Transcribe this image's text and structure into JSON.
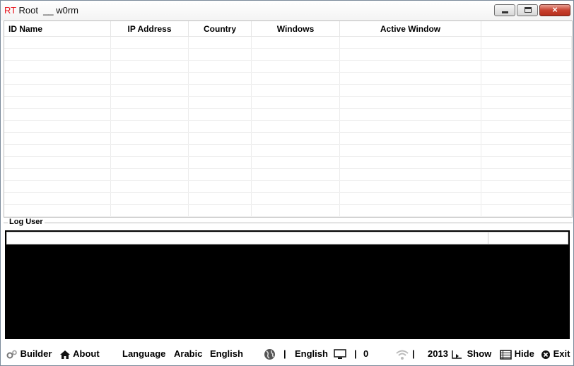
{
  "window": {
    "title_prefix": "RT",
    "title_rest": " Root  __ w0rm"
  },
  "grid": {
    "columns": [
      "ID Name",
      "IP Address",
      "Country",
      "Windows",
      "Active Window",
      ""
    ],
    "rows": []
  },
  "log": {
    "label": "Log User"
  },
  "statusbar": {
    "builder": "Builder",
    "about": "About",
    "language": "Language",
    "arabic": "Arabic",
    "english": "English",
    "sep1": "|",
    "lang_current": "English",
    "sep2": "|",
    "count": "0",
    "sep3": "|",
    "year": "2013",
    "show": "Show",
    "hide": "Hide",
    "exit": "Exit"
  },
  "icons": {
    "builder": "gears-icon",
    "about": "home-icon",
    "language": "globe-icon",
    "monitor": "monitor-icon",
    "wifi": "wifi-icon",
    "show": "show-icon",
    "hide": "hide-icon",
    "exit": "exit-icon"
  },
  "colors": {
    "title_accent": "#e8141c",
    "log_background": "#000000"
  }
}
